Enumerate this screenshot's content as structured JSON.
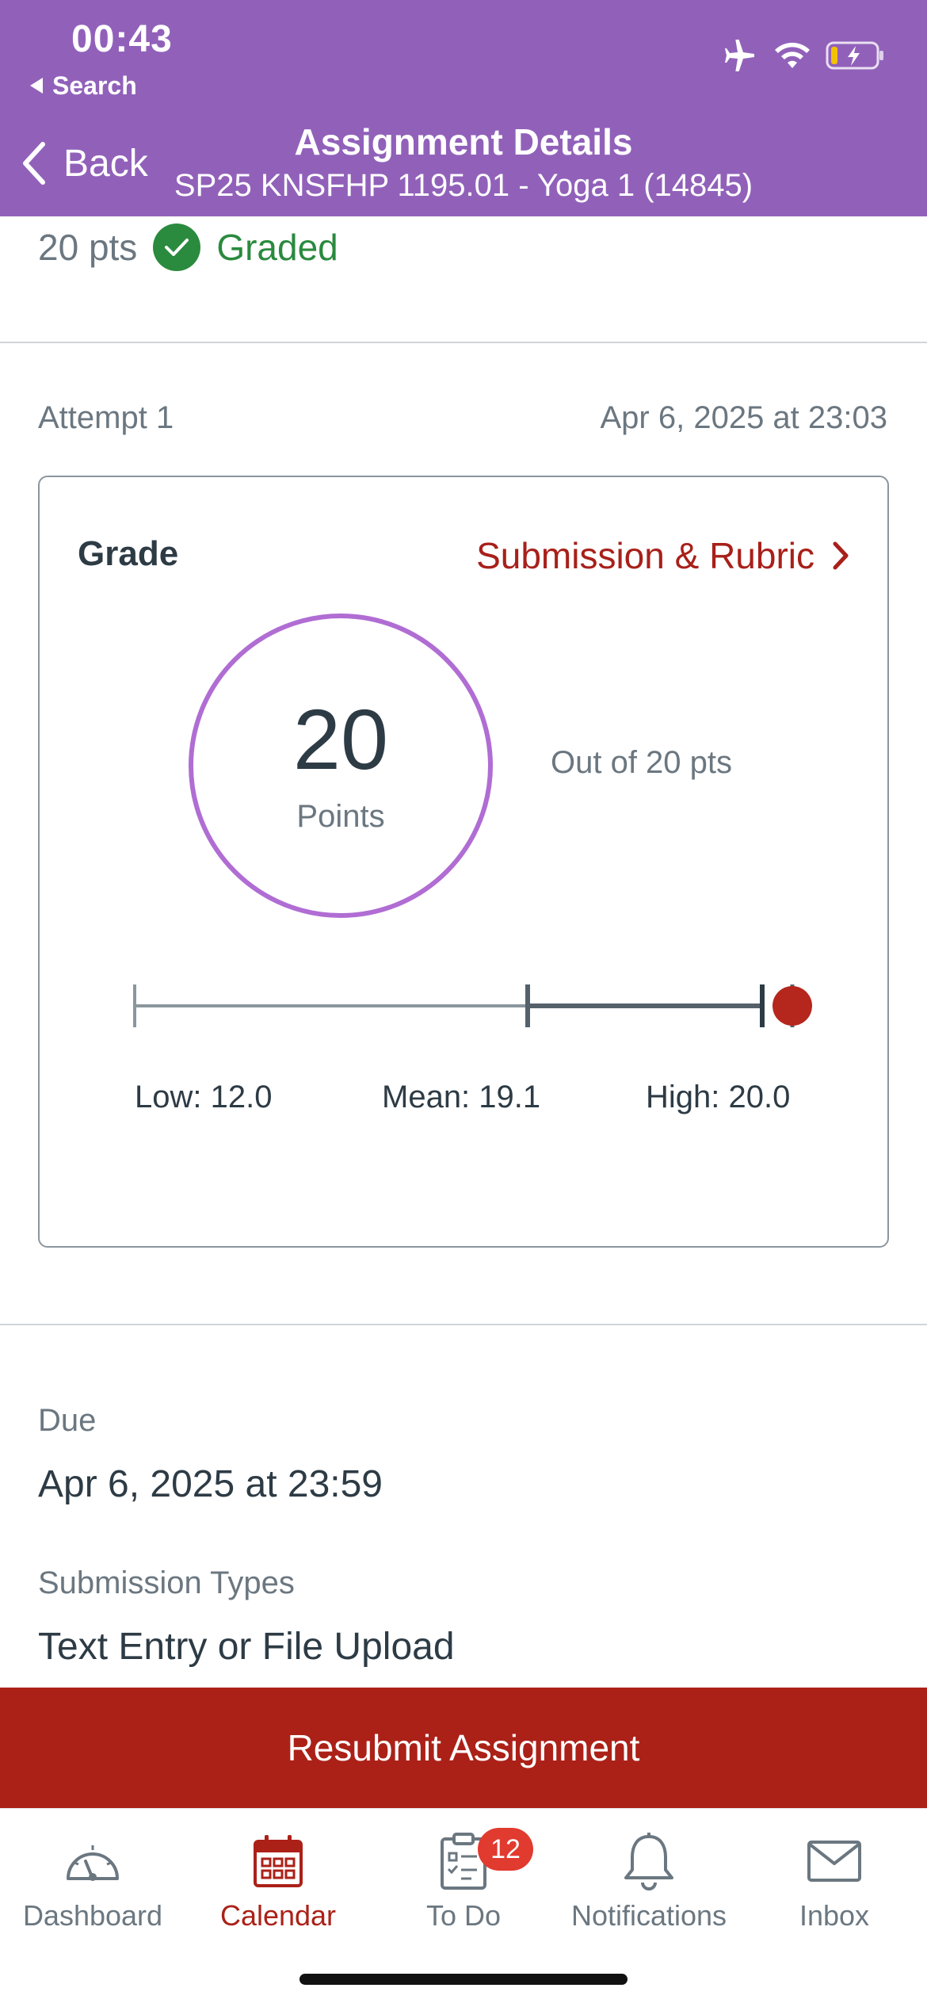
{
  "status": {
    "time": "00:43",
    "back_app": "Search"
  },
  "nav": {
    "back_label": "Back",
    "title": "Assignment Details",
    "subtitle": "SP25 KNSFHP 1195.01 - Yoga 1 (14845)"
  },
  "assignment": {
    "points": "20 pts",
    "status": "Graded"
  },
  "attempt": {
    "label": "Attempt 1",
    "date": "Apr 6, 2025 at 23:03"
  },
  "grade": {
    "title": "Grade",
    "link": "Submission & Rubric",
    "score": "20",
    "score_label": "Points",
    "out_of": "Out of 20 pts",
    "stats": {
      "low": 12.0,
      "mean": 19.1,
      "high": 20.0,
      "score": 20
    },
    "low_label": "Low: 12.0",
    "mean_label": "Mean: 19.1",
    "high_label": "High: 20.0"
  },
  "details": {
    "due_label": "Due",
    "due_value": "Apr 6, 2025 at 23:59",
    "submission_types_label": "Submission Types",
    "submission_types_value": "Text Entry or File Upload"
  },
  "actions": {
    "resubmit": "Resubmit Assignment"
  },
  "tabs": [
    {
      "label": "Dashboard",
      "icon": "dashboard-icon"
    },
    {
      "label": "Calendar",
      "icon": "calendar-icon",
      "active": true
    },
    {
      "label": "To Do",
      "icon": "todo-icon",
      "badge": "12"
    },
    {
      "label": "Notifications",
      "icon": "bell-icon"
    },
    {
      "label": "Inbox",
      "icon": "inbox-icon"
    }
  ],
  "colors": {
    "header": "#9161ba",
    "accent": "#ab2118",
    "success": "#2a8a3e",
    "ring": "#b06dd3"
  }
}
